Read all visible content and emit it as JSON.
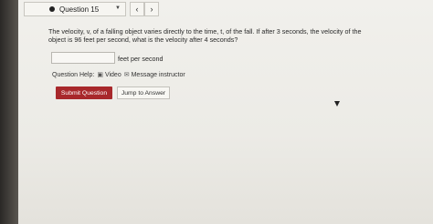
{
  "header": {
    "question_selector": "Question 15",
    "prev_symbol": "‹",
    "next_symbol": "›"
  },
  "question": {
    "text": "The velocity, v, of a falling object varies directly to the time, t, of the fall. If after 3 seconds, the velocity of the object is 96 feet per second, what is the velocity after 4 seconds?"
  },
  "answer": {
    "value": "",
    "units": "feet per second"
  },
  "help": {
    "label": "Question Help:",
    "video_label": "Video",
    "message_label": "Message instructor"
  },
  "actions": {
    "submit_label": "Submit Question",
    "jump_label": "Jump to Answer"
  },
  "colors": {
    "submit_bg": "#a8282b",
    "page_bg": "#eeede8"
  }
}
